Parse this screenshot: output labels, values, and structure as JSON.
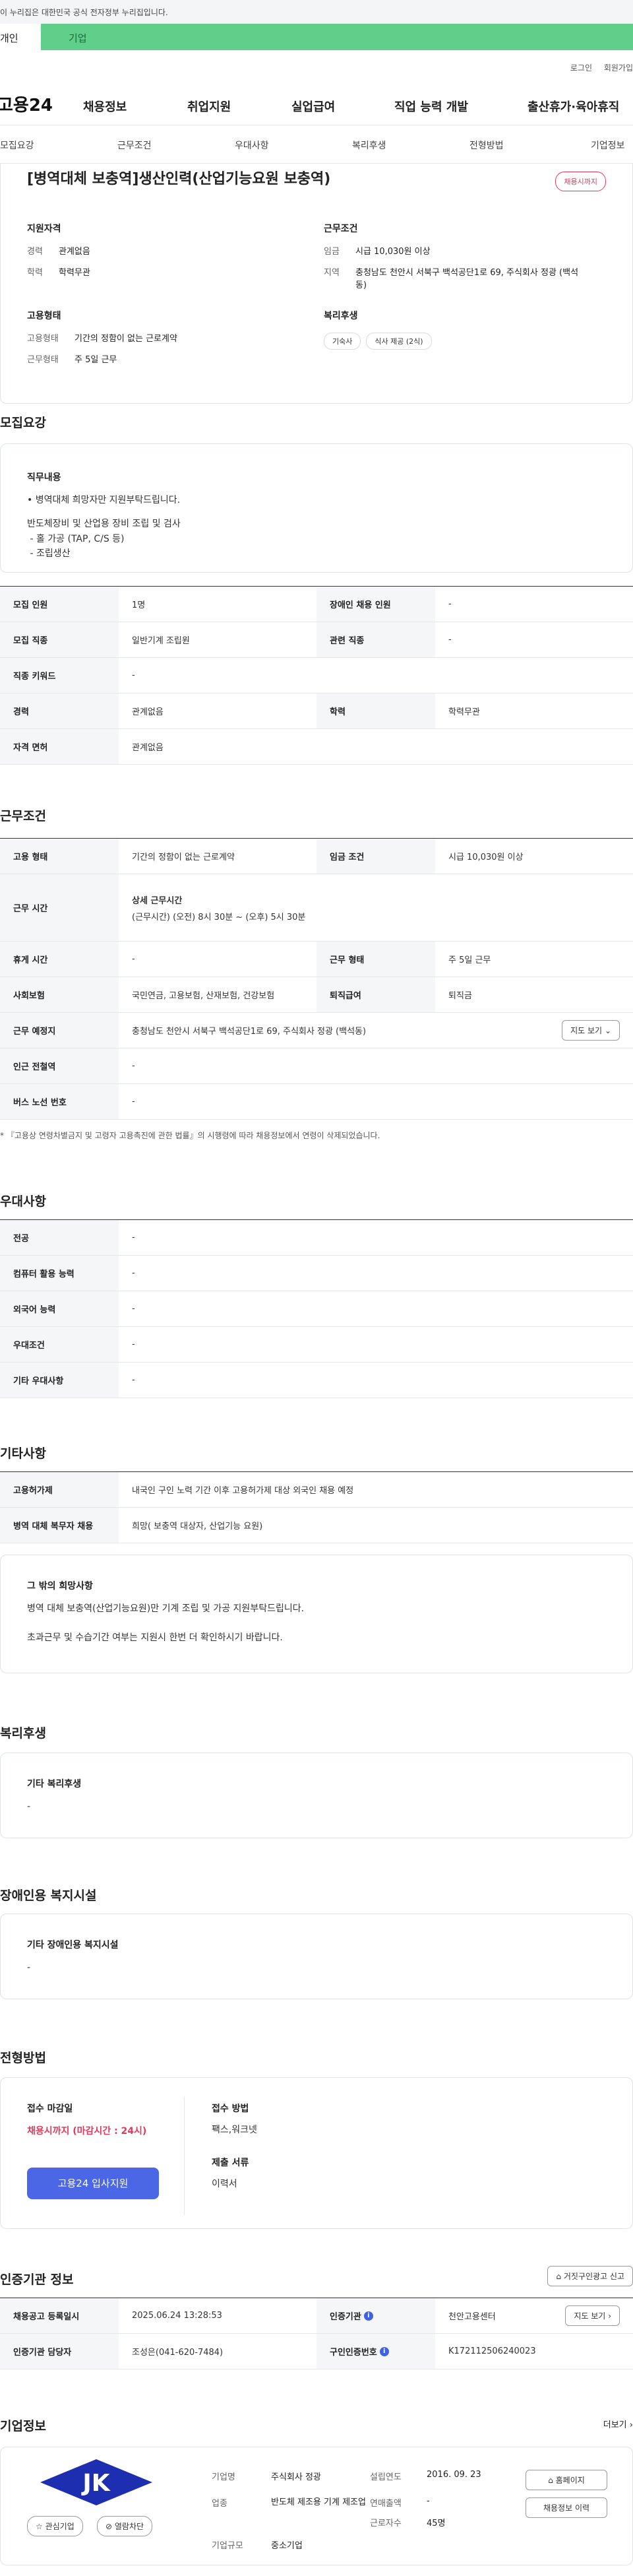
{
  "gov_notice": "이 누리집은 대한민국 공식 전자정부 누리집입니다.",
  "tabs": {
    "individual": "개인",
    "company": "기업"
  },
  "util": {
    "login": "로그인",
    "join": "회원가입"
  },
  "logo": "고용24",
  "gnb": [
    "채용정보",
    "취업지원",
    "실업급여",
    "직업 능력 개발",
    "출산휴가·육아휴직"
  ],
  "subnav": [
    "모집요강",
    "근무조건",
    "우대사항",
    "복리후생",
    "전형방법",
    "기업정보"
  ],
  "summary": {
    "title": "[병역대체 보충역]생산인력(산업기능요원 보충역)",
    "deadline": "채용시까지",
    "qualification": {
      "heading": "지원자격",
      "rows": [
        {
          "k": "경력",
          "v": "관계없음"
        },
        {
          "k": "학력",
          "v": "학력무관"
        }
      ]
    },
    "conditions": {
      "heading": "근무조건",
      "rows": [
        {
          "k": "임금",
          "v": "시급 10,030원 이상"
        },
        {
          "k": "지역",
          "v": "충청남도 천안시 서북구 백석공단1로 69, 주식회사 정광 (백석동)"
        }
      ]
    },
    "employment": {
      "heading": "고용형태",
      "rows": [
        {
          "k": "고용형태",
          "v": "기간의 정함이 없는 근로계약"
        },
        {
          "k": "근무형태",
          "v": "주 5일 근무"
        }
      ]
    },
    "welfare": {
      "heading": "복리후생",
      "pills": [
        "기숙사",
        "식사 제공 (2식)"
      ]
    }
  },
  "recruit": {
    "title": "모집요강",
    "duty_heading": "직무내용",
    "duty_lines": [
      "• 병역대체 희망자만 지원부탁드립니다.",
      "",
      "반도체장비 및 산업용 장비 조립 및 검사",
      " - 홀 가공 (TAP, C/S 등)",
      " - 조립생산"
    ],
    "table": {
      "count_k": "모집 인원",
      "count_v": "1명",
      "disabled_k": "장애인 채용 인원",
      "disabled_v": "-",
      "job_k": "모집 직종",
      "job_v": "일반기계 조립원",
      "related_k": "관련 직종",
      "related_v": "-",
      "keyword_k": "직종 키워드",
      "keyword_v": "-",
      "career_k": "경력",
      "career_v": "관계없음",
      "edu_k": "학력",
      "edu_v": "학력무관",
      "license_k": "자격 면허",
      "license_v": "관계없음"
    }
  },
  "work": {
    "title": "근무조건",
    "type_k": "고용 형태",
    "type_v": "기간의 정함이 없는 근로계약",
    "wage_k": "임금 조건",
    "wage_v": "시급 10,030원 이상",
    "hours_k": "근무 시간",
    "hours_h": "상세 근무시간",
    "hours_v": "(근무시간) (오전) 8시 30분 ~ (오후) 5시 30분",
    "break_k": "휴게 시간",
    "break_v": "-",
    "form_k": "근무 형태",
    "form_v": "주 5일 근무",
    "ins_k": "사회보험",
    "ins_v": "국민연금, 고용보험, 산재보험, 건강보험",
    "retire_k": "퇴직급여",
    "retire_v": "퇴직금",
    "place_k": "근무 예정지",
    "place_v": "충청남도 천안시 서북구 백석공단1로 69, 주식회사 정광 (백석동)",
    "map_btn": "지도 보기",
    "subway_k": "인근 전철역",
    "subway_v": "-",
    "bus_k": "버스 노선 번호",
    "bus_v": "-",
    "note": "* 『고용상 연령차별금지 및 고령자 고용촉진에 관한 법률』의 시행령에 따라 채용정보에서 연령이 삭제되었습니다."
  },
  "prefer": {
    "title": "우대사항",
    "rows": [
      {
        "k": "전공",
        "v": "-"
      },
      {
        "k": "컴퓨터 활용 능력",
        "v": "-"
      },
      {
        "k": "외국어 능력",
        "v": "-"
      },
      {
        "k": "우대조건",
        "v": "-"
      },
      {
        "k": "기타 우대사항",
        "v": "-"
      }
    ]
  },
  "etc": {
    "title": "기타사항",
    "rows": [
      {
        "k": "고용허가제",
        "v": "내국인 구인 노력 기간 이후 고용허가제 대상 외국인 채용 예정"
      },
      {
        "k": "병역 대체 복무자 채용",
        "v": "희망( 보충역 대상자, 산업기능 요원)"
      }
    ],
    "box_heading": "그 밖의 희망사항",
    "box_line1": "병역 대체 보충역(산업기능요원)만 기계 조립 및 가공 지원부탁드립니다.",
    "box_line2": "초과근무 및 수습기간 여부는 지원시 한번 더 확인하시기 바랍니다."
  },
  "welfare": {
    "title": "복리후생",
    "heading": "기타 복리후생",
    "value": "-"
  },
  "disabled": {
    "title": "장애인용 복지시설",
    "heading": "기타 장애인용 복지시설",
    "value": "-"
  },
  "process": {
    "title": "전형방법",
    "deadline_h": "접수 마감일",
    "deadline_v": "채용시까지 (마감시간 : 24시)",
    "method_h": "접수 방법",
    "method_v": "팩스,워크넷",
    "docs_h": "제출 서류",
    "docs_v": "이력서",
    "apply": "고용24 입사지원"
  },
  "cert": {
    "title": "인증기관 정보",
    "report_btn": "거짓구인광고 신고",
    "reg_k": "채용공고 등록일시",
    "reg_v": "2025.06.24 13:28:53",
    "org_k": "인증기관",
    "org_v": "천안고용센터",
    "map_btn": "지도 보기",
    "mgr_k": "인증기관 담당자",
    "mgr_v": "조성은(041-620-7484)",
    "no_k": "구인인증번호",
    "no_v": "K172112506240023"
  },
  "company": {
    "title": "기업정보",
    "more": "더보기",
    "logo_text": "JK",
    "fav": "관심기업",
    "block": "열람차단",
    "name_k": "기업명",
    "name_v": "주식회사 정광",
    "year_k": "설립연도",
    "year_v": "2016. 09. 23",
    "ind_k": "업종",
    "ind_v": "반도체 제조용 기계 제조업",
    "sales_k": "연매출액",
    "sales_v": "-",
    "size_k": "기업규모",
    "size_v": "중소기업",
    "emp_k": "근로자수",
    "emp_v": "45명",
    "home_btn": "홈페이지",
    "history_btn": "채용정보 이력"
  }
}
